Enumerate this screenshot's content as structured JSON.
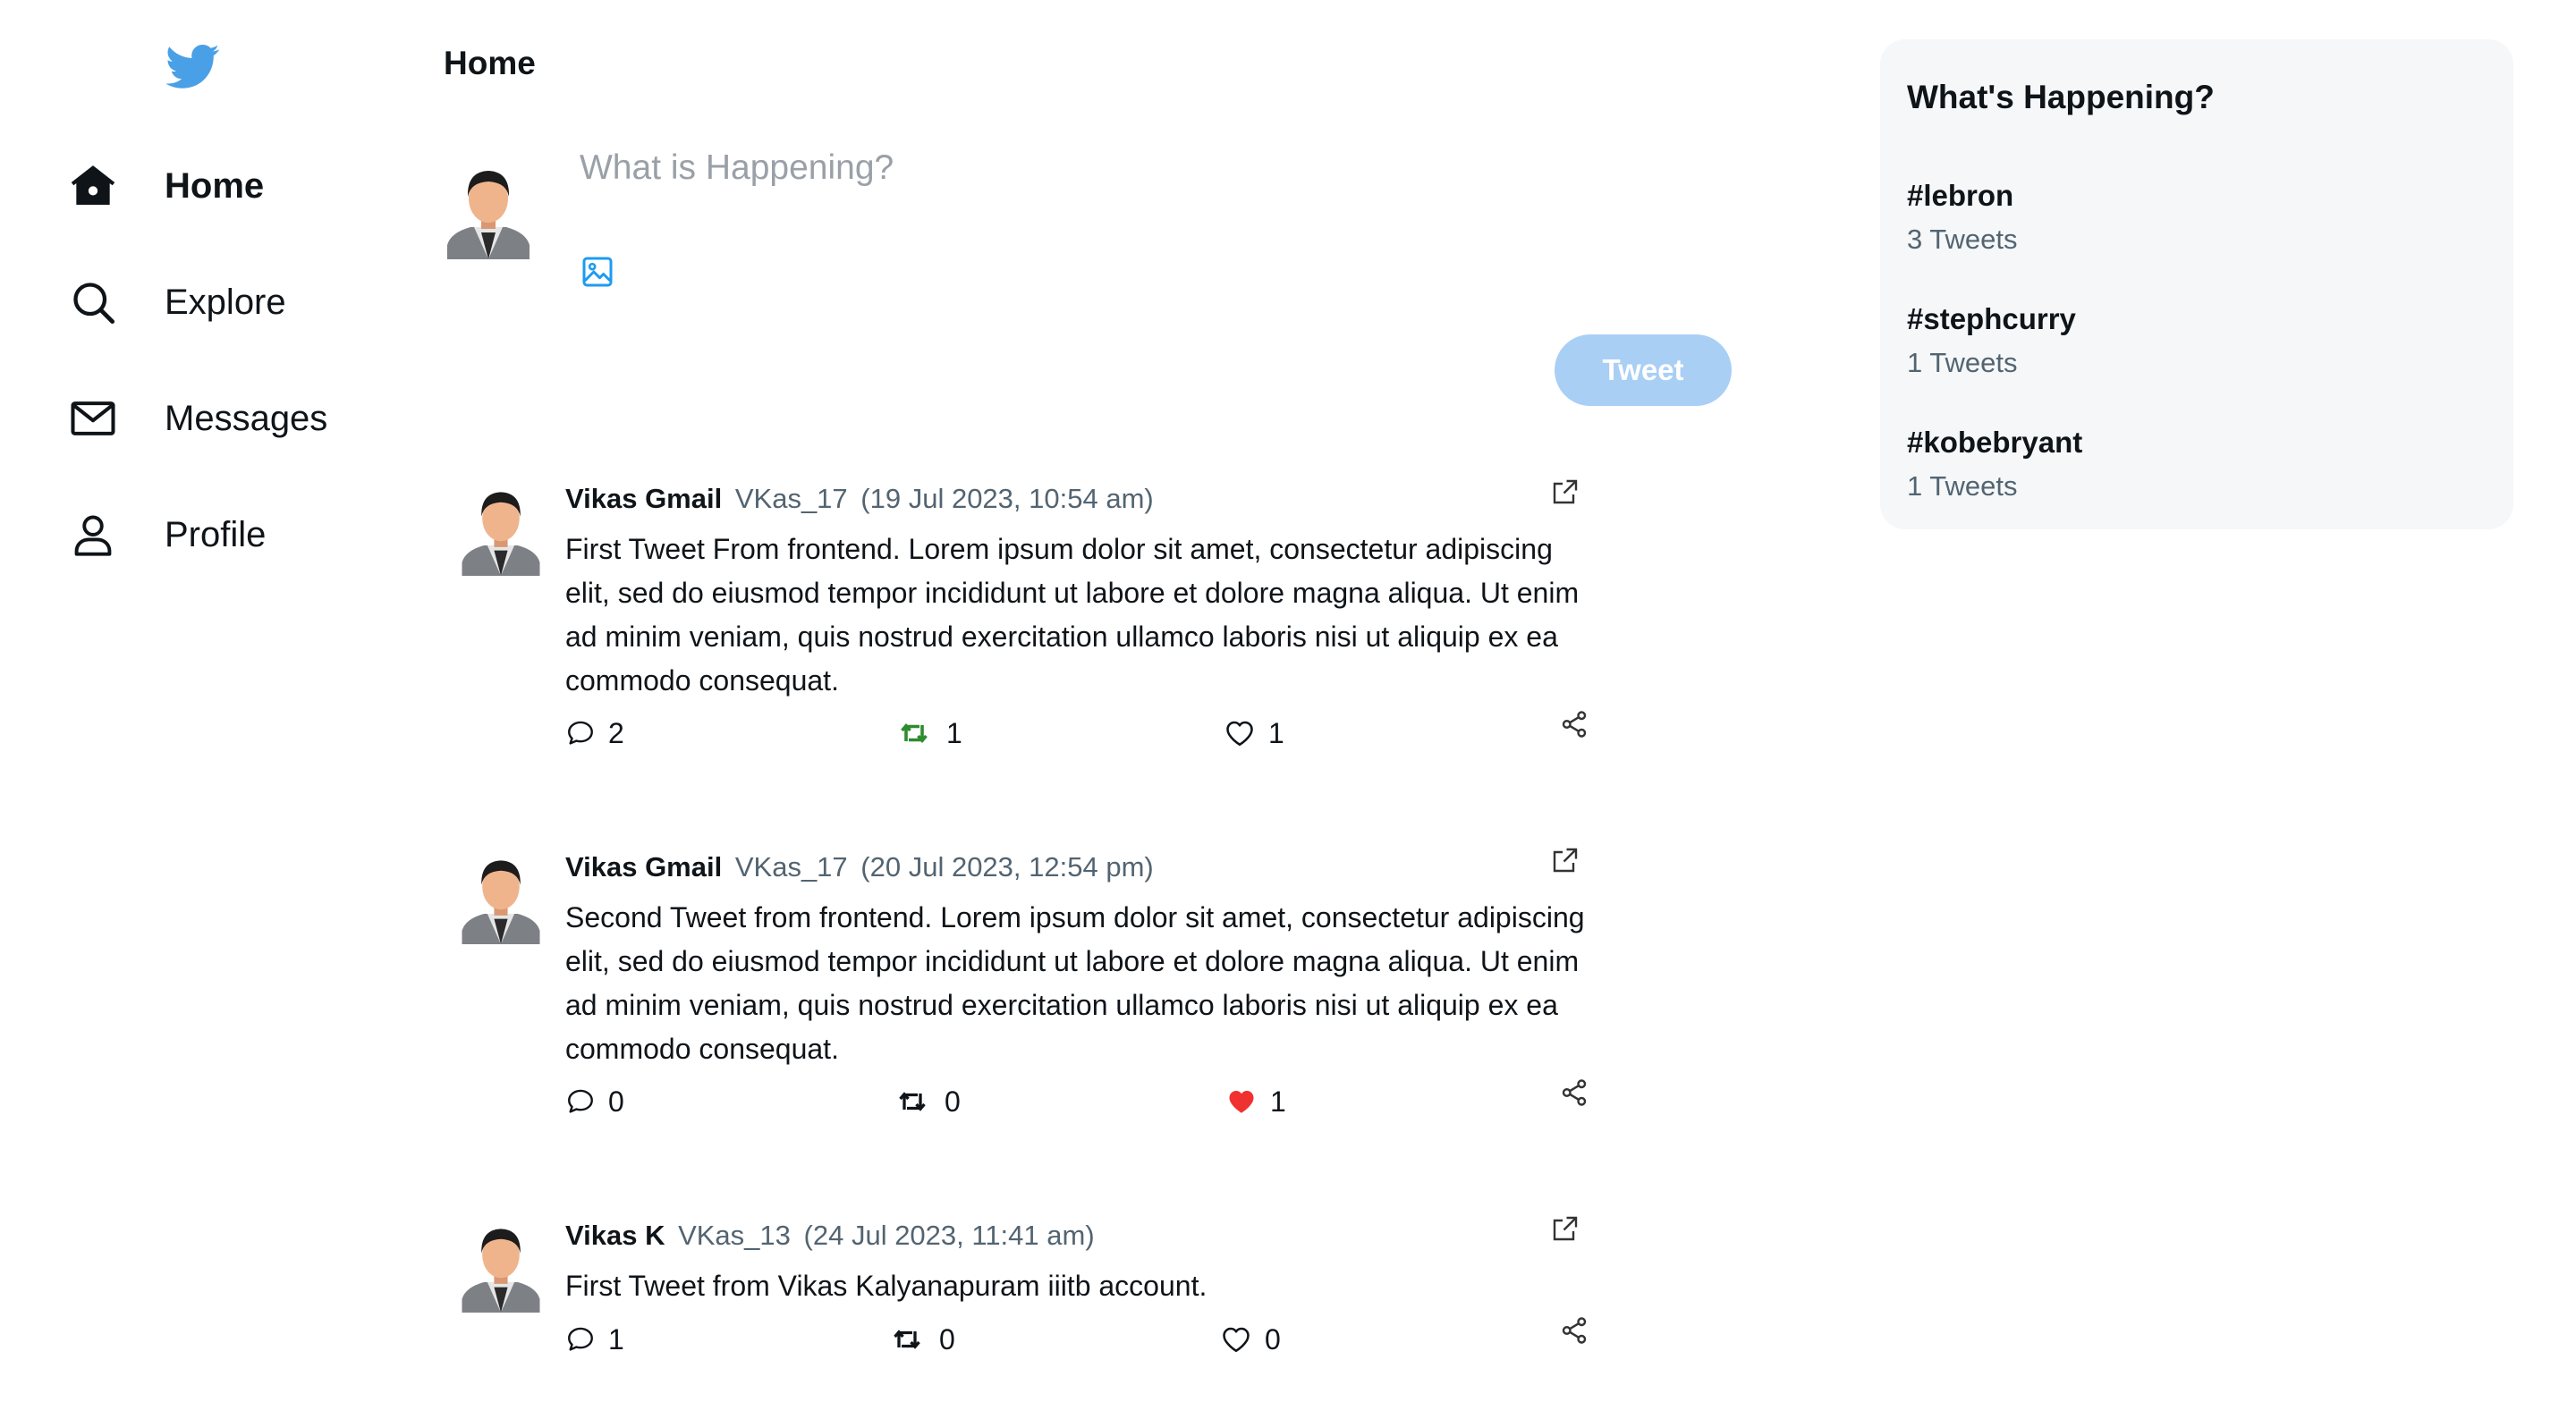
{
  "app": {
    "brand_color": "#1d9bf0",
    "logo_icon": "twitter-bird-icon"
  },
  "sidebar": {
    "items": [
      {
        "label": "Home",
        "icon": "home-icon",
        "active": true
      },
      {
        "label": "Explore",
        "icon": "search-icon",
        "active": false
      },
      {
        "label": "Messages",
        "icon": "mail-icon",
        "active": false
      },
      {
        "label": "Profile",
        "icon": "user-icon",
        "active": false
      }
    ]
  },
  "main": {
    "title": "Home",
    "compose": {
      "placeholder": "What is Happening?",
      "media_icon": "image-icon",
      "button_label": "Tweet",
      "button_color": "#a9cff5"
    },
    "tweets": [
      {
        "name": "Vikas Gmail",
        "handle": "VKas_17",
        "time": "(19 Jul 2023, 10:54 am)",
        "text": "First Tweet From frontend. Lorem ipsum dolor sit amet, consectetur adipiscing elit, sed do eiusmod tempor incididunt ut labore et dolore magna aliqua. Ut enim ad minim veniam, quis nostrud exercitation ullamco laboris nisi ut aliquip ex ea commodo consequat.",
        "replies": "2",
        "retweets": "1",
        "likes": "1",
        "retweeted": true,
        "liked": false
      },
      {
        "name": "Vikas Gmail",
        "handle": "VKas_17",
        "time": "(20 Jul 2023, 12:54 pm)",
        "text": "Second Tweet from frontend. Lorem ipsum dolor sit amet, consectetur adipiscing elit, sed do eiusmod tempor incididunt ut labore et dolore magna aliqua. Ut enim ad minim veniam, quis nostrud exercitation ullamco laboris nisi ut aliquip ex ea commodo consequat.",
        "replies": "0",
        "retweets": "0",
        "likes": "1",
        "retweeted": false,
        "liked": true
      },
      {
        "name": "Vikas K",
        "handle": "VKas_13",
        "time": "(24 Jul 2023, 11:41 am)",
        "text": "First Tweet from Vikas Kalyanapuram iiitb account.",
        "replies": "1",
        "retweets": "0",
        "likes": "0",
        "retweeted": false,
        "liked": false
      }
    ]
  },
  "trends": {
    "title": "What's Happening?",
    "items": [
      {
        "tag": "#lebron",
        "count": "3 Tweets"
      },
      {
        "tag": "#stephcurry",
        "count": "1 Tweets"
      },
      {
        "tag": "#kobebryant",
        "count": "1 Tweets"
      }
    ]
  },
  "colors": {
    "retweet_active": "#2e8b2e",
    "like_active": "#f0312f",
    "secondary_text": "#536471",
    "panel_bg": "#f5f7f9"
  }
}
